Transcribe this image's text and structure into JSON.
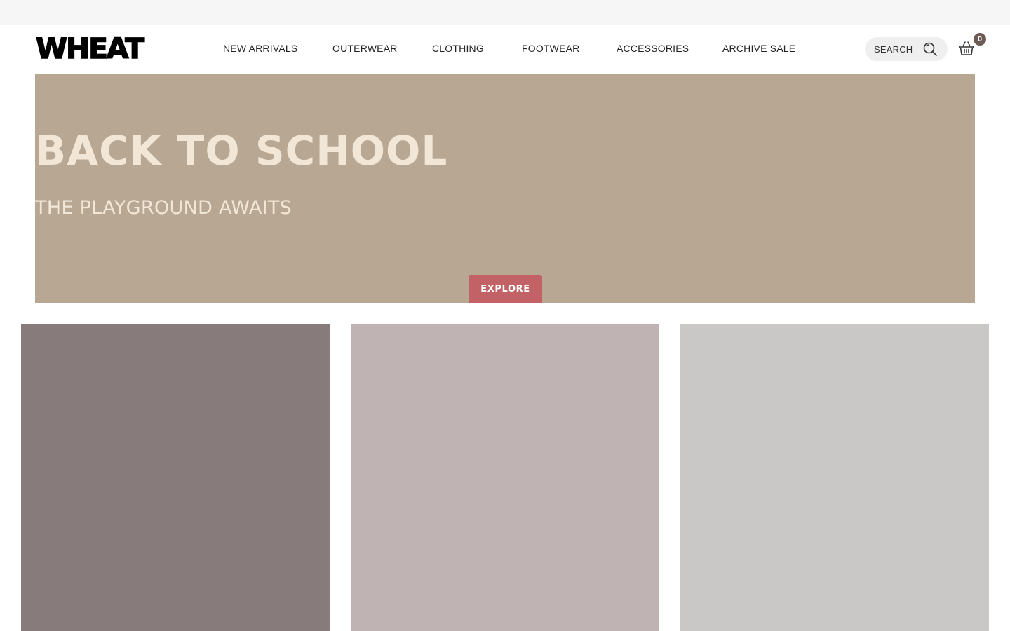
{
  "header": {
    "logo_text": "WHEAT",
    "nav": [
      {
        "label": "NEW ARRIVALS"
      },
      {
        "label": "OUTERWEAR"
      },
      {
        "label": "CLOTHING"
      },
      {
        "label": "FOOTWEAR"
      },
      {
        "label": "ACCESSORIES"
      },
      {
        "label": "ARCHIVE SALE"
      }
    ],
    "search": {
      "label": "SEARCH",
      "icon": "search-icon"
    },
    "cart": {
      "icon": "basket-icon",
      "count": "0"
    }
  },
  "hero": {
    "title": "BACK TO SCHOOL",
    "subtitle": "THE PLAYGROUND AWAITS",
    "button_label": "EXPLORE"
  },
  "colors": {
    "topbar": "#f6f6f6",
    "hero_bg": "#b8a893",
    "hero_text": "#f2e6d7",
    "button": "#c26266",
    "badge": "#6e5b56",
    "tiles": [
      "#887b7b",
      "#bfb3b4",
      "#c9c8c7"
    ]
  }
}
